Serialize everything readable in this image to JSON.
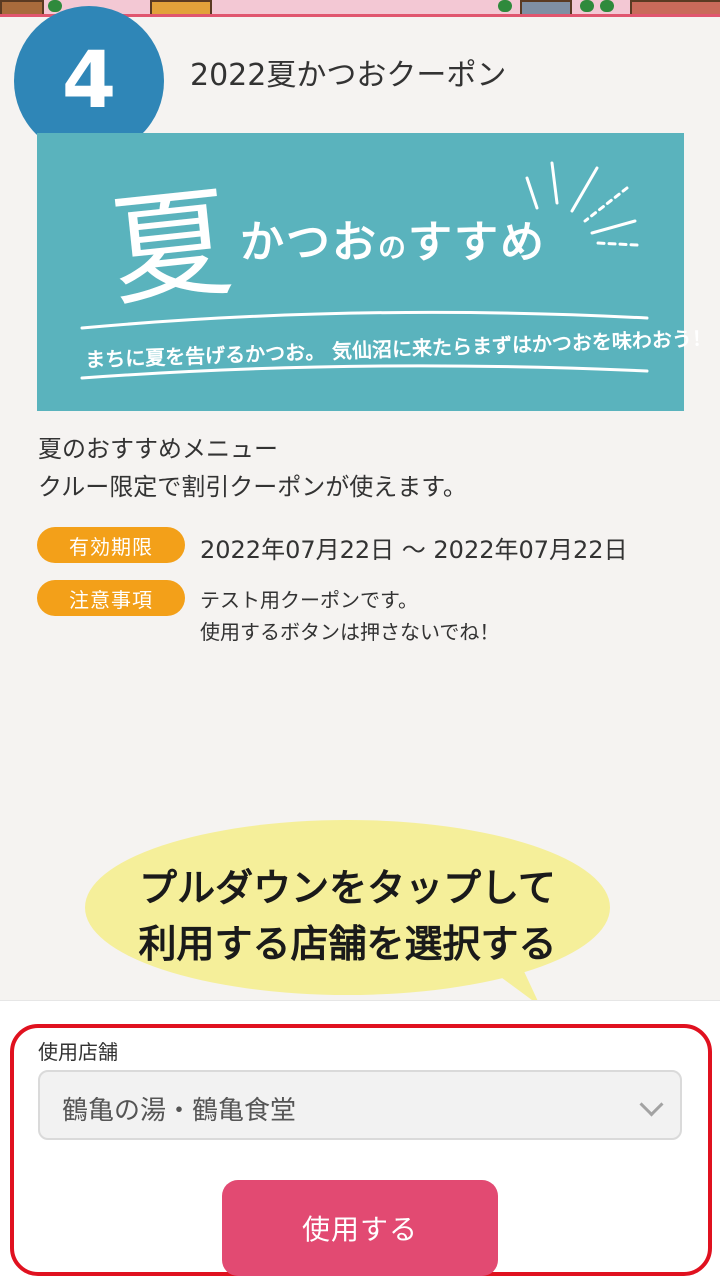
{
  "step_number": "4",
  "coupon_title": "2022夏かつおクーポン",
  "banner": {
    "kanji": "夏",
    "main_prefix": "かつお",
    "main_particle": "の",
    "main_suffix": "すすめ",
    "subtitle": "まちに夏を告げるかつお。 気仙沼に来たらまずはかつおを味わおう！"
  },
  "description": {
    "line1": "夏のおすすめメニュー",
    "line2": "クルー限定で割引クーポンが使えます。"
  },
  "validity": {
    "label": "有効期限",
    "value": "2022年07月22日 〜 2022年07月22日"
  },
  "notes": {
    "label": "注意事項",
    "line1": "テスト用クーポンです。",
    "line2": "使用するボタンは押さないでね！"
  },
  "bubble": {
    "line1": "プルダウンをタップして",
    "line2": "利用する店舗を選択する"
  },
  "store": {
    "label": "使用店舗",
    "selected": "鶴亀の湯・鶴亀食堂"
  },
  "use_button_label": "使用する",
  "colors": {
    "step_circle": "#2f86b7",
    "banner_bg": "#5ab3bd",
    "pill": "#f3a019",
    "bubble": "#f5ef9a",
    "highlight_frame": "#e0111f",
    "use_button": "#e24a72"
  }
}
